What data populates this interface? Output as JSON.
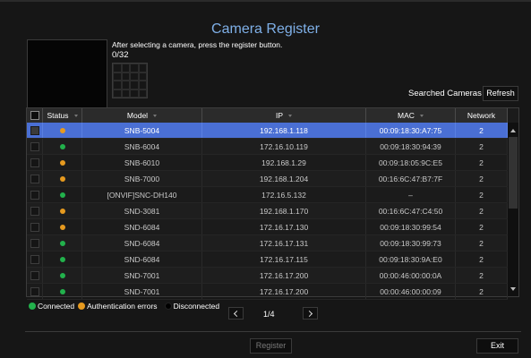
{
  "title": "Camera Register",
  "instruction": "After selecting a camera, press the register button.",
  "count": "0/32",
  "searched_label": "Searched Cameras",
  "refresh_label": "Refresh",
  "columns": {
    "status": "Status",
    "model": "Model",
    "ip": "IP",
    "mac": "MAC",
    "network": "Network"
  },
  "status_colors": {
    "connected": "#22b14c",
    "auth_error": "#e69a1f",
    "disconnected": "#000000",
    "selected_row": "#4a6fd4"
  },
  "rows": [
    {
      "status": "auth_error",
      "model": "SNB-5004",
      "ip": "192.168.1.118",
      "mac": "00:09:18:30:A7:75",
      "network": "2",
      "selected": true
    },
    {
      "status": "connected",
      "model": "SNB-6004",
      "ip": "172.16.10.119",
      "mac": "00:09:18:30:94:39",
      "network": "2"
    },
    {
      "status": "auth_error",
      "model": "SNB-6010",
      "ip": "192.168.1.29",
      "mac": "00:09:18:05:9C:E5",
      "network": "2"
    },
    {
      "status": "auth_error",
      "model": "SNB-7000",
      "ip": "192.168.1.204",
      "mac": "00:16:6C:47:B7:7F",
      "network": "2"
    },
    {
      "status": "connected",
      "model": "[ONVIF]SNC-DH140",
      "ip": "172.16.5.132",
      "mac": "–",
      "network": "2"
    },
    {
      "status": "auth_error",
      "model": "SND-3081",
      "ip": "192.168.1.170",
      "mac": "00:16:6C:47:C4:50",
      "network": "2"
    },
    {
      "status": "auth_error",
      "model": "SND-6084",
      "ip": "172.16.17.130",
      "mac": "00:09:18:30:99:54",
      "network": "2"
    },
    {
      "status": "connected",
      "model": "SND-6084",
      "ip": "172.16.17.131",
      "mac": "00:09:18:30:99:73",
      "network": "2"
    },
    {
      "status": "connected",
      "model": "SND-6084",
      "ip": "172.16.17.115",
      "mac": "00:09:18:30:9A:E0",
      "network": "2"
    },
    {
      "status": "connected",
      "model": "SND-7001",
      "ip": "172.16.17.200",
      "mac": "00:00:46:00:00:0A",
      "network": "2"
    },
    {
      "status": "connected",
      "model": "SND-7001",
      "ip": "172.16.17.200",
      "mac": "00:00:46:00:00:09",
      "network": "2"
    }
  ],
  "legend": {
    "connected": "Connected",
    "auth_error": "Authentication errors",
    "disconnected": "Disconnected"
  },
  "page_indicator": "1/4",
  "register_label": "Register",
  "exit_label": "Exit"
}
